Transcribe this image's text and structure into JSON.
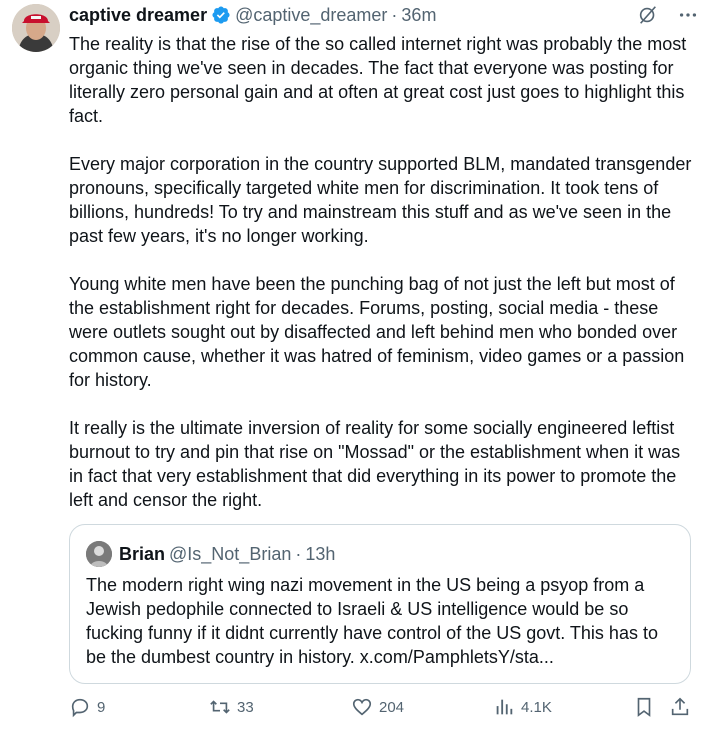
{
  "author": {
    "name": "captive dreamer",
    "handle": "@captive_dreamer",
    "time": "36m",
    "verified": true
  },
  "tweet": {
    "paragraphs": [
      "The reality is that the rise of the so called internet right was probably the most organic thing we've seen in decades.  The fact that everyone was posting for literally zero personal gain and at often at great cost just goes to highlight this fact.",
      "Every major corporation in the country supported BLM, mandated transgender pronouns, specifically targeted white men for discrimination. It took tens of billions, hundreds! To try and mainstream this stuff and as we've seen in the past few years, it's no longer working.",
      "Young white men have been the punching bag of not just the left but most of the establishment right for decades.  Forums, posting, social media - these were outlets sought out by disaffected and left behind men who bonded over common cause, whether it was hatred of feminism, video games or a passion for history.",
      "It really is the ultimate inversion of reality for some socially engineered leftist burnout to try and pin that rise on \"Mossad\" or the establishment when it was in fact that very establishment that did everything in its power to promote the left and censor the right."
    ]
  },
  "quote": {
    "name": "Brian",
    "handle": "@Is_Not_Brian",
    "time": "13h",
    "text": "The modern right wing nazi movement in the US being a psyop from a Jewish pedophile connected to Israeli & US intelligence would be so fucking funny if it didnt currently have control of the US govt. This has to be the dumbest country in history. x.com/PamphletsY/sta..."
  },
  "actions": {
    "replies": "9",
    "reposts": "33",
    "likes": "204",
    "views": "4.1K"
  },
  "colors": {
    "text": "#0f1419",
    "secondary": "#536471",
    "verified": "#1d9bf0",
    "border": "#cfd9de"
  },
  "icons": {
    "header": [
      "grok-icon",
      "more-icon"
    ],
    "actions": [
      "reply-icon",
      "repost-icon",
      "like-icon",
      "views-icon",
      "bookmark-icon",
      "share-icon"
    ]
  }
}
